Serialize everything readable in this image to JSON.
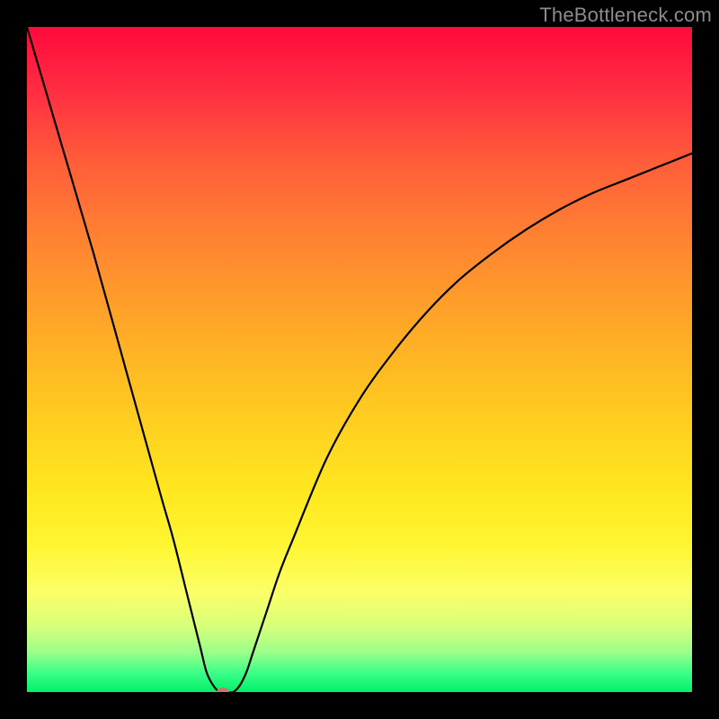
{
  "watermark": "TheBottleneck.com",
  "colors": {
    "curve": "#000000",
    "dot": "#c9776c",
    "frame": "#000000"
  },
  "chart_data": {
    "type": "line",
    "title": "",
    "xlabel": "",
    "ylabel": "",
    "xlim": [
      0,
      100
    ],
    "ylim": [
      0,
      100
    ],
    "grid": false,
    "series": [
      {
        "name": "bottleneck-curve",
        "x": [
          0,
          5,
          10,
          15,
          20,
          22,
          24,
          26,
          27,
          28,
          29,
          30,
          31,
          32,
          33,
          34,
          36,
          38,
          40,
          45,
          50,
          55,
          60,
          65,
          70,
          75,
          80,
          85,
          90,
          95,
          100
        ],
        "y": [
          100,
          83,
          66,
          48,
          30,
          23,
          15,
          7,
          3,
          1,
          0,
          0,
          0,
          1,
          3,
          6,
          12,
          18,
          23,
          35,
          44,
          51,
          57,
          62,
          66,
          69.5,
          72.5,
          75,
          77,
          79,
          81
        ]
      }
    ],
    "annotations": [
      {
        "name": "min-marker-dot",
        "x": 29.5,
        "y": 0
      }
    ]
  }
}
